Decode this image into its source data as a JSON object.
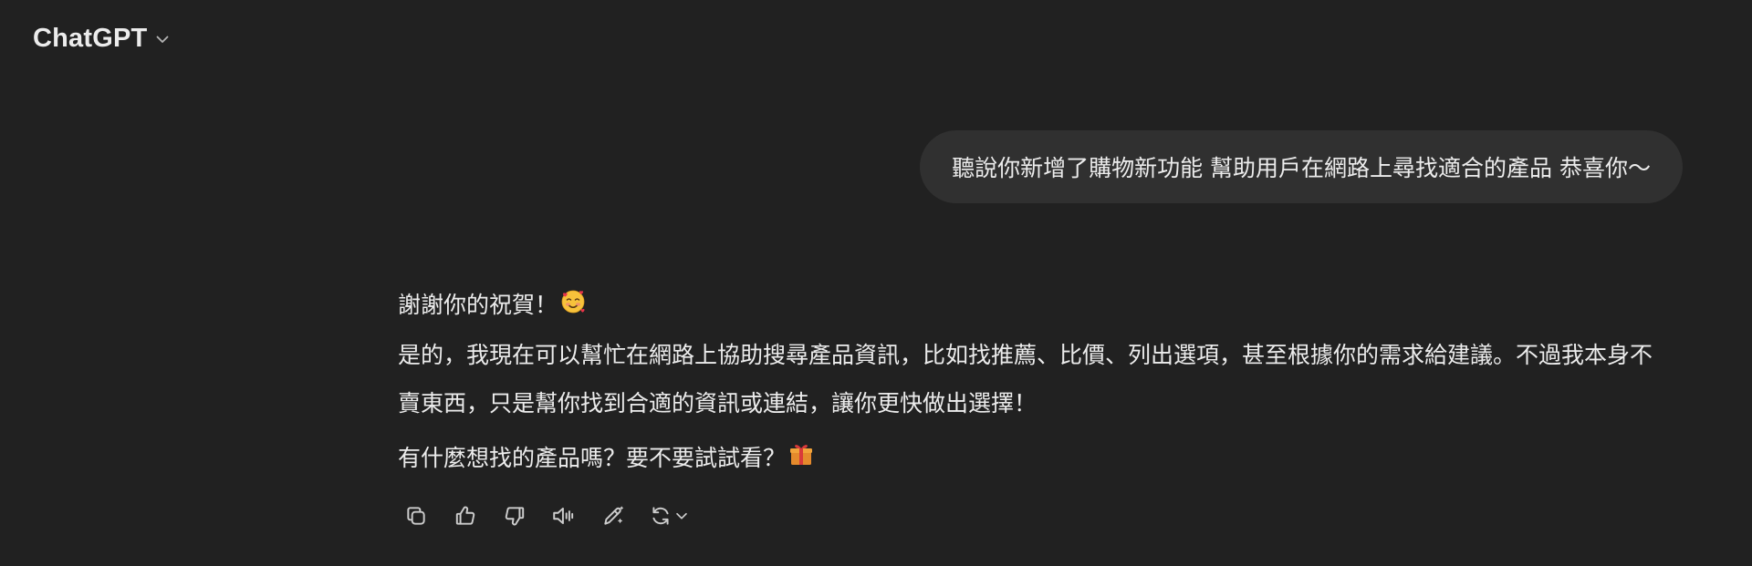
{
  "header": {
    "model_name": "ChatGPT",
    "chevron_icon": "chevron-down-icon"
  },
  "user_message": {
    "text": "聽說你新增了購物新功能 幫助用戶在網路上尋找適合的產品 恭喜你～"
  },
  "assistant_message": {
    "line1": "謝謝你的祝賀！",
    "line1_emoji": "smiling-face-with-hearts",
    "paragraph1": "是的，我現在可以幫忙在網路上協助搜尋產品資訊，比如找推薦、比價、列出選項，甚至根據你的需求給建議。不過我本身不賣東西，只是幫你找到合適的資訊或連結，讓你更快做出選擇！",
    "paragraph2": "有什麼想找的產品嗎？要不要試試看？",
    "paragraph2_emoji": "wrapped-gift"
  },
  "actions": [
    {
      "name": "copy-icon"
    },
    {
      "name": "thumbs-up-icon"
    },
    {
      "name": "thumbs-down-icon"
    },
    {
      "name": "read-aloud-icon"
    },
    {
      "name": "edit-in-canvas-icon"
    },
    {
      "name": "regenerate-icon"
    }
  ],
  "colors": {
    "background": "#212121",
    "user_bubble": "#303030",
    "text": "#ececec",
    "icon": "#cdcdcd"
  }
}
